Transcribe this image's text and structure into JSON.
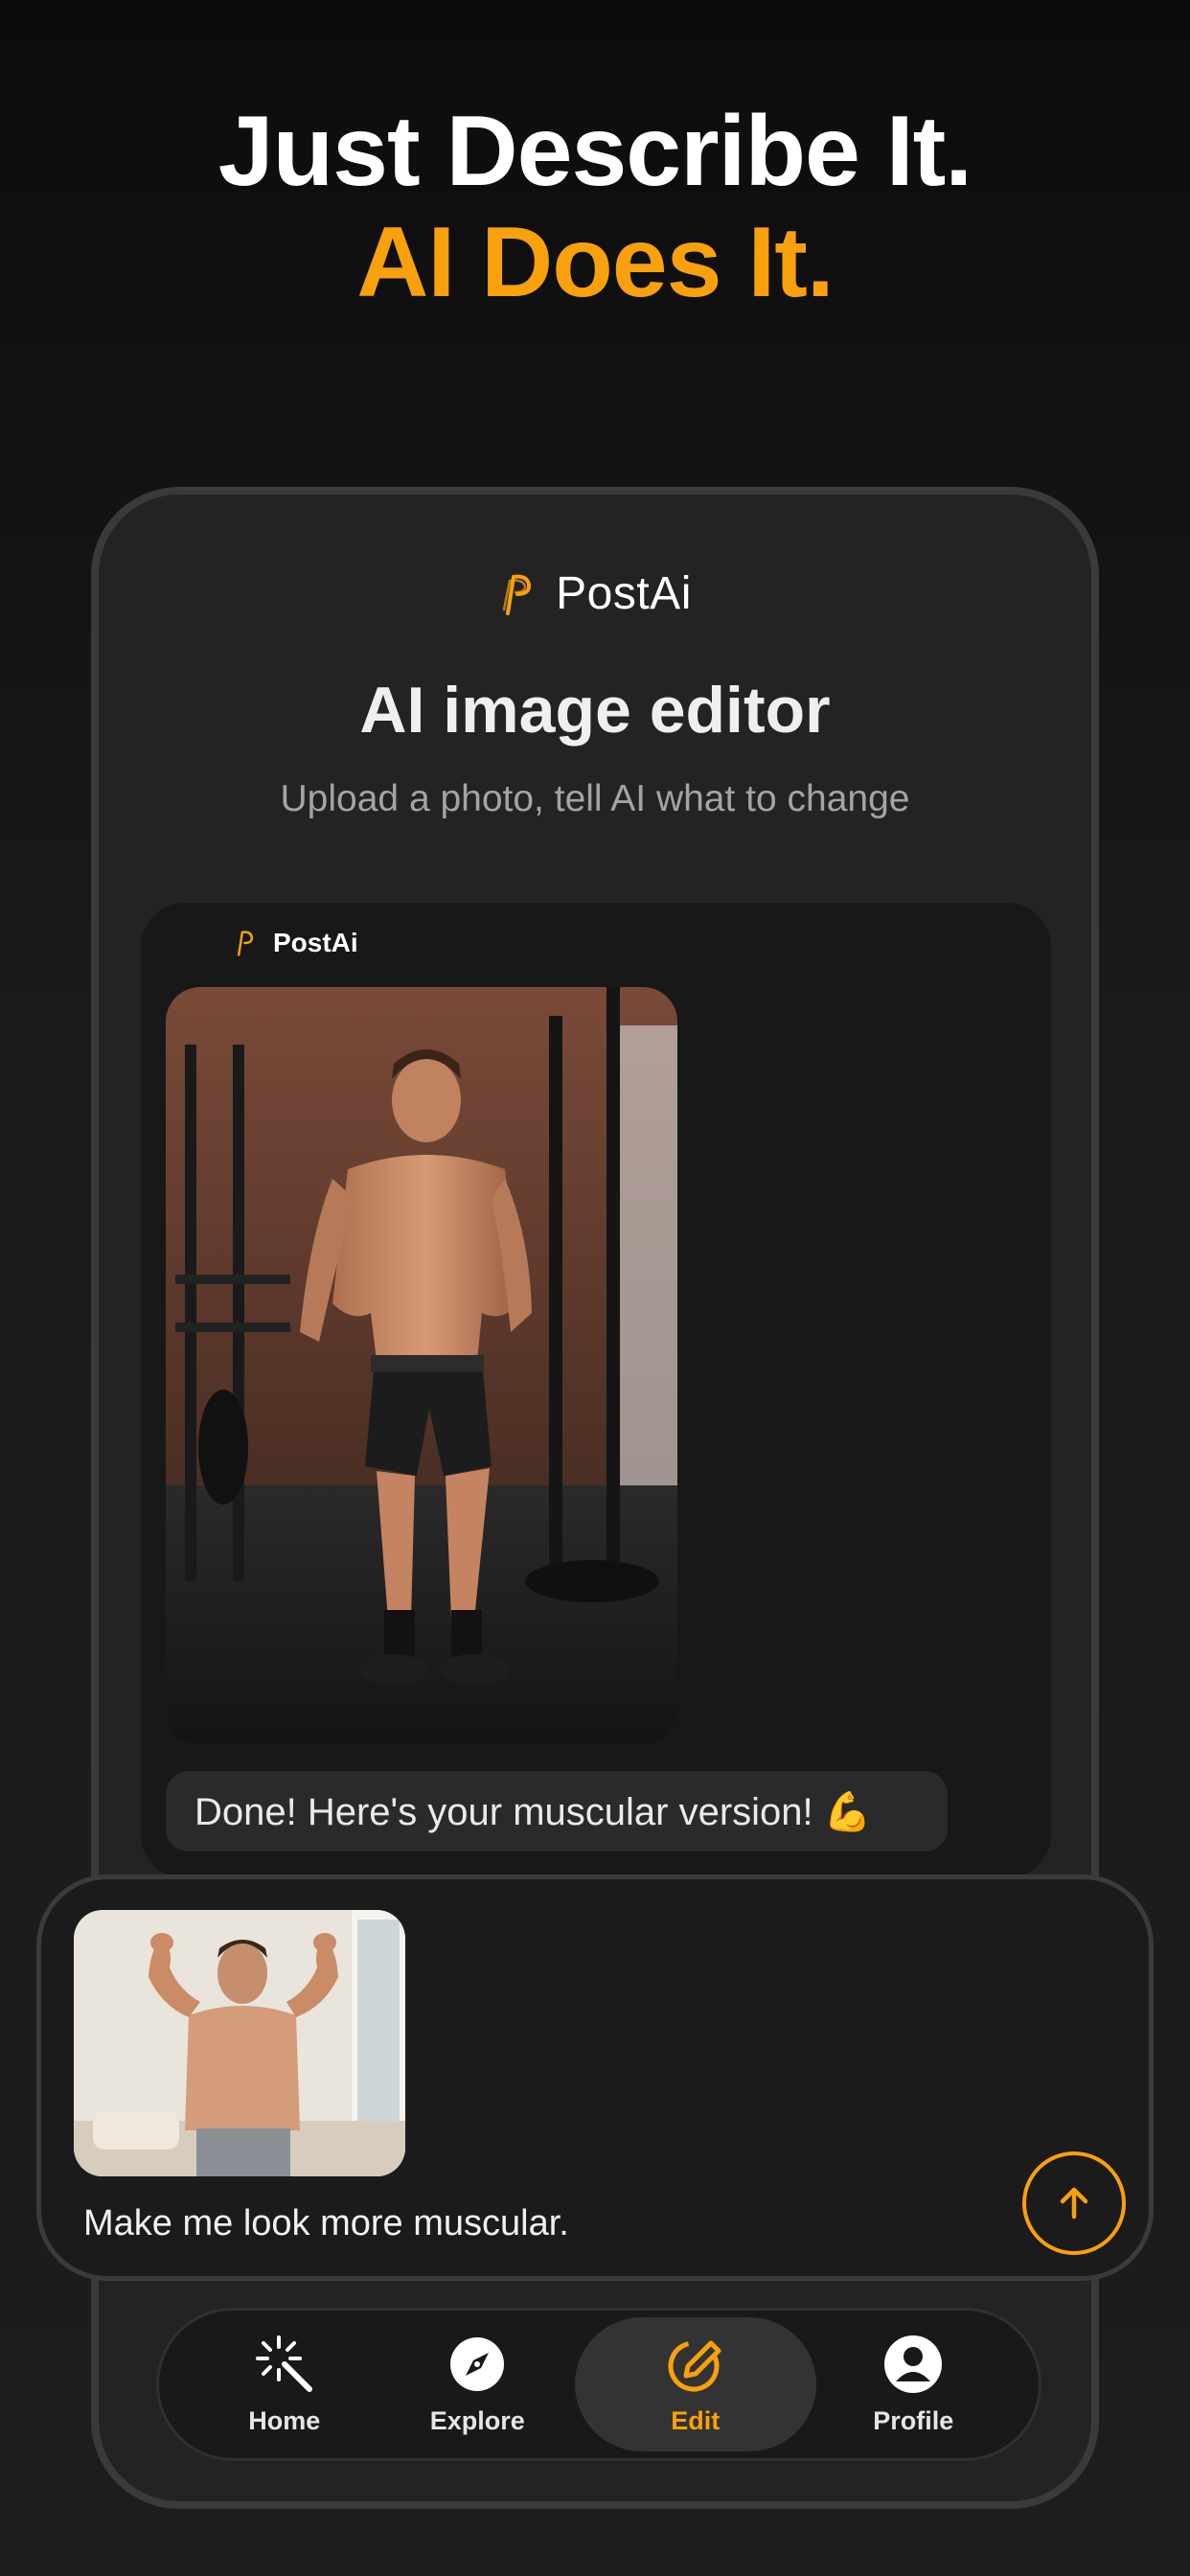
{
  "headline": {
    "line1": "Just Describe It.",
    "line2": "AI Does It."
  },
  "app": {
    "brand": "PostAi",
    "title": "AI image editor",
    "subtitle": "Upload a photo, tell AI what to change"
  },
  "chat": {
    "sender": "PostAi",
    "result_image": "muscular-gym-photo",
    "reply": "Done! Here's your muscular version! 💪"
  },
  "composer": {
    "attachment_image": "flexing-man-photo",
    "prompt": "Make me look more muscular."
  },
  "nav": {
    "items": [
      {
        "label": "Home",
        "icon": "magic-wand-icon"
      },
      {
        "label": "Explore",
        "icon": "compass-icon"
      },
      {
        "label": "Edit",
        "icon": "edit-pencil-icon",
        "active": true
      },
      {
        "label": "Profile",
        "icon": "user-icon"
      }
    ]
  },
  "colors": {
    "accent": "#f8a10c",
    "background": "#1a1a1a",
    "card": "#181818"
  }
}
